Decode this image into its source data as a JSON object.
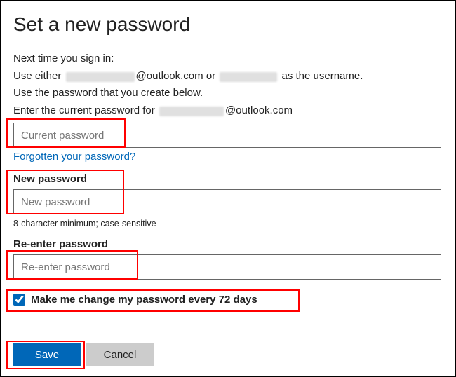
{
  "heading": "Set a new password",
  "intro": {
    "nextTime": "Next time you sign in:",
    "useEitherPrefix": "Use either",
    "outlookSuffix": "@outlook.com or",
    "asUsername": "as the username.",
    "usePassword": "Use the password that you create below.",
    "enterCurrentPrefix": "Enter the current password for",
    "enterCurrentSuffix": "@outlook.com"
  },
  "fields": {
    "current": {
      "placeholder": "Current password"
    },
    "forgotLink": "Forgotten your password?",
    "newLabel": "New password",
    "new": {
      "placeholder": "New password"
    },
    "hint": "8-character minimum; case-sensitive",
    "reenterLabel": "Re-enter password",
    "reenter": {
      "placeholder": "Re-enter password"
    }
  },
  "checkbox": {
    "label": "Make me change my password every 72 days",
    "checked": true
  },
  "buttons": {
    "save": "Save",
    "cancel": "Cancel"
  }
}
